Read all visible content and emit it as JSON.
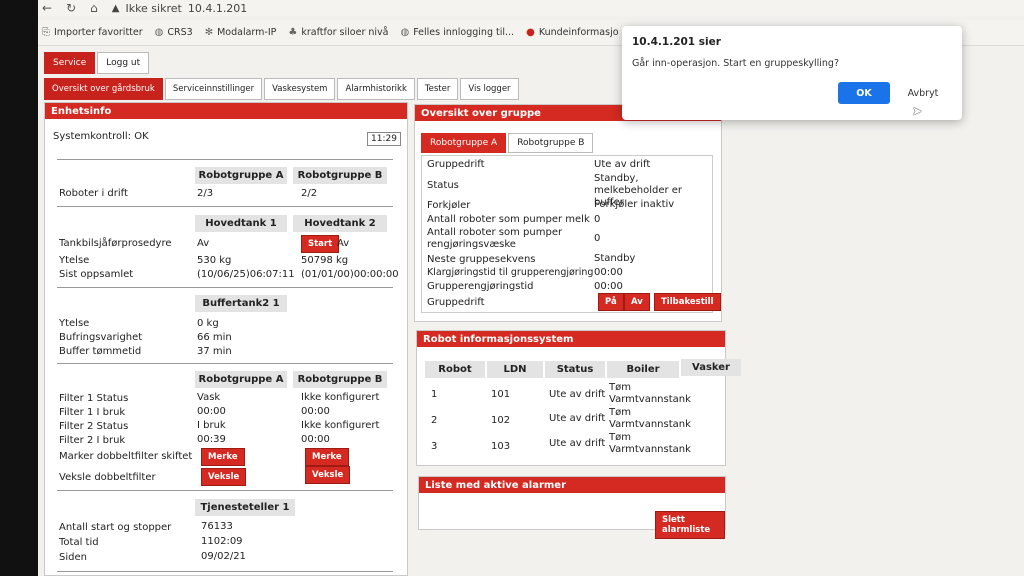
{
  "browser": {
    "security": "Ikke sikret",
    "address": "10.4.1.201"
  },
  "favorites": [
    {
      "icon": "import-icon",
      "label": "Importer favoritter"
    },
    {
      "icon": "globe-icon",
      "label": "CRS3"
    },
    {
      "icon": "gear-icon",
      "label": "Modalarm-IP"
    },
    {
      "icon": "leaf-icon",
      "label": "kraftfor siloer nivå"
    },
    {
      "icon": "globe-icon",
      "label": "Felles innlogging til..."
    },
    {
      "icon": "info-icon",
      "label": "Kundeinformasjo"
    }
  ],
  "top_buttons": {
    "service": "Service",
    "logout": "Logg ut"
  },
  "tabs": [
    "Oversikt over gårdsbruk",
    "Serviceinnstillinger",
    "Vaskesystem",
    "Alarmhistorikk",
    "Tester",
    "Vis logger"
  ],
  "enhetsinfo": {
    "title": "Enhetsinfo",
    "systemkontroll": "Systemkontroll: OK",
    "clock": "11:29",
    "robotgruppe_a": "Robotgruppe A",
    "robotgruppe_b": "Robotgruppe B",
    "roboter_label": "Roboter i drift",
    "roboter_a": "2/3",
    "roboter_b": "2/2",
    "hovedtank1": "Hovedtank 1",
    "hovedtank2": "Hovedtank 2",
    "tankbil_label": "Tankbilsjåførprosedyre",
    "tankbil_1": "Av",
    "start_btn": "Start",
    "tankbil_2": "Av",
    "ytelse_label": "Ytelse",
    "ytelse_1": "530 kg",
    "ytelse_2": "50798 kg",
    "oppsamlet_label": "Sist oppsamlet",
    "oppsamlet_1": "(10/06/25)06:07:11",
    "oppsamlet_2": "(01/01/00)00:00:00",
    "buffertank": "Buffertank2 1",
    "b_ytelse_label": "Ytelse",
    "b_ytelse": "0 kg",
    "b_varighet_label": "Bufringsvarighet",
    "b_varighet": "66 min",
    "b_tomme_label": "Buffer tømmetid",
    "b_tomme": "37 min",
    "f_grp_a": "Robotgruppe A",
    "f_grp_b": "Robotgruppe B",
    "f1s_label": "Filter 1 Status",
    "f1s_a": "Vask",
    "f1s_b": "Ikke konfigurert",
    "f1b_label": "Filter 1 I bruk",
    "f1b_a": "00:00",
    "f1b_b": "00:00",
    "f2s_label": "Filter 2 Status",
    "f2s_a": "I bruk",
    "f2s_b": "Ikke konfigurert",
    "f2b_label": "Filter 2 I bruk",
    "f2b_a": "00:39",
    "f2b_b": "00:00",
    "marker_label": "Marker dobbeltfilter skiftet",
    "merke": "Merke",
    "veksle_label": "Veksle dobbeltfilter",
    "veksle": "Veksle",
    "tjeneste": "Tjenesteteller 1",
    "start_stopp_label": "Antall start og stopper",
    "start_stopp": "76133",
    "total_label": "Total tid",
    "total": "1102:09",
    "siden_label": "Siden",
    "siden": "09/02/21"
  },
  "gruppe": {
    "title": "Oversikt over gruppe",
    "tab_a": "Robotgruppe A",
    "tab_b": "Robotgruppe B",
    "rows": [
      {
        "label": "Gruppedrift",
        "value": "Ute av drift"
      },
      {
        "label": "Status",
        "value": "Standby, melkebeholder er buffer"
      },
      {
        "label": "Forkjøler",
        "value": "Forkjøler inaktiv"
      },
      {
        "label": "Antall roboter som pumper melk",
        "value": "0"
      },
      {
        "label": "Antall roboter som pumper rengjøringsvæske",
        "value": "0"
      },
      {
        "label": "Neste gruppesekvens",
        "value": "Standby"
      },
      {
        "label": "Klargjøringstid til grupperengjøring",
        "value": "00:00"
      },
      {
        "label": "Grupperengjøringstid",
        "value": "00:00"
      }
    ],
    "gruppedrift_label": "Gruppedrift",
    "pa": "På",
    "av": "Av",
    "tilbakestill": "Tilbakestill"
  },
  "robotinfo": {
    "title": "Robot informasjonssystem",
    "headers": [
      "Robot",
      "LDN",
      "Status",
      "Boiler",
      "Vasker"
    ],
    "rows": [
      {
        "robot": "1",
        "ldn": "101",
        "status": "Ute av drift",
        "boiler": "Tøm Varmtvannstank"
      },
      {
        "robot": "2",
        "ldn": "102",
        "status": "Ute av drift",
        "boiler": "Tøm Varmtvannstank"
      },
      {
        "robot": "3",
        "ldn": "103",
        "status": "Ute av drift",
        "boiler": "Tøm Varmtvannstank"
      }
    ]
  },
  "alarms": {
    "title": "Liste med aktive alarmer",
    "clear": "Slett alarmliste"
  },
  "dialog": {
    "title": "10.4.1.201 sier",
    "message": "Går inn-operasjon. Start en gruppeskylling?",
    "ok": "OK",
    "cancel": "Avbryt"
  },
  "colors": {
    "accent": "#d42a22",
    "ok_button": "#1a73e8"
  }
}
